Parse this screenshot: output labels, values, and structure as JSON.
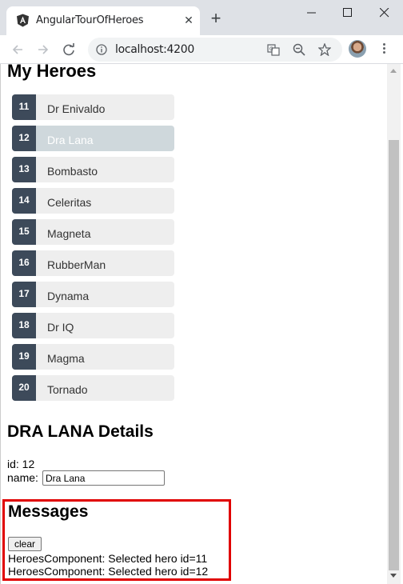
{
  "browser": {
    "tab_title": "AngularTourOfHeroes",
    "url": "localhost:4200",
    "accent": "#dee1e6"
  },
  "page": {
    "heroes_title": "My Heroes",
    "heroes": [
      {
        "id": "11",
        "name": "Dr Enivaldo",
        "selected": false
      },
      {
        "id": "12",
        "name": "Dra Lana",
        "selected": true
      },
      {
        "id": "13",
        "name": "Bombasto",
        "selected": false
      },
      {
        "id": "14",
        "name": "Celeritas",
        "selected": false
      },
      {
        "id": "15",
        "name": "Magneta",
        "selected": false
      },
      {
        "id": "16",
        "name": "RubberMan",
        "selected": false
      },
      {
        "id": "17",
        "name": "Dynama",
        "selected": false
      },
      {
        "id": "18",
        "name": "Dr IQ",
        "selected": false
      },
      {
        "id": "19",
        "name": "Magma",
        "selected": false
      },
      {
        "id": "20",
        "name": "Tornado",
        "selected": false
      }
    ],
    "details_title": "DRA LANA Details",
    "id_line": "id: 12",
    "name_label": "name:",
    "name_value": "Dra Lana",
    "messages_title": "Messages",
    "clear_label": "clear",
    "messages": [
      "HeroesComponent: Selected hero id=11",
      "HeroesComponent: Selected hero id=12"
    ],
    "highlight_color": "#e00000"
  }
}
